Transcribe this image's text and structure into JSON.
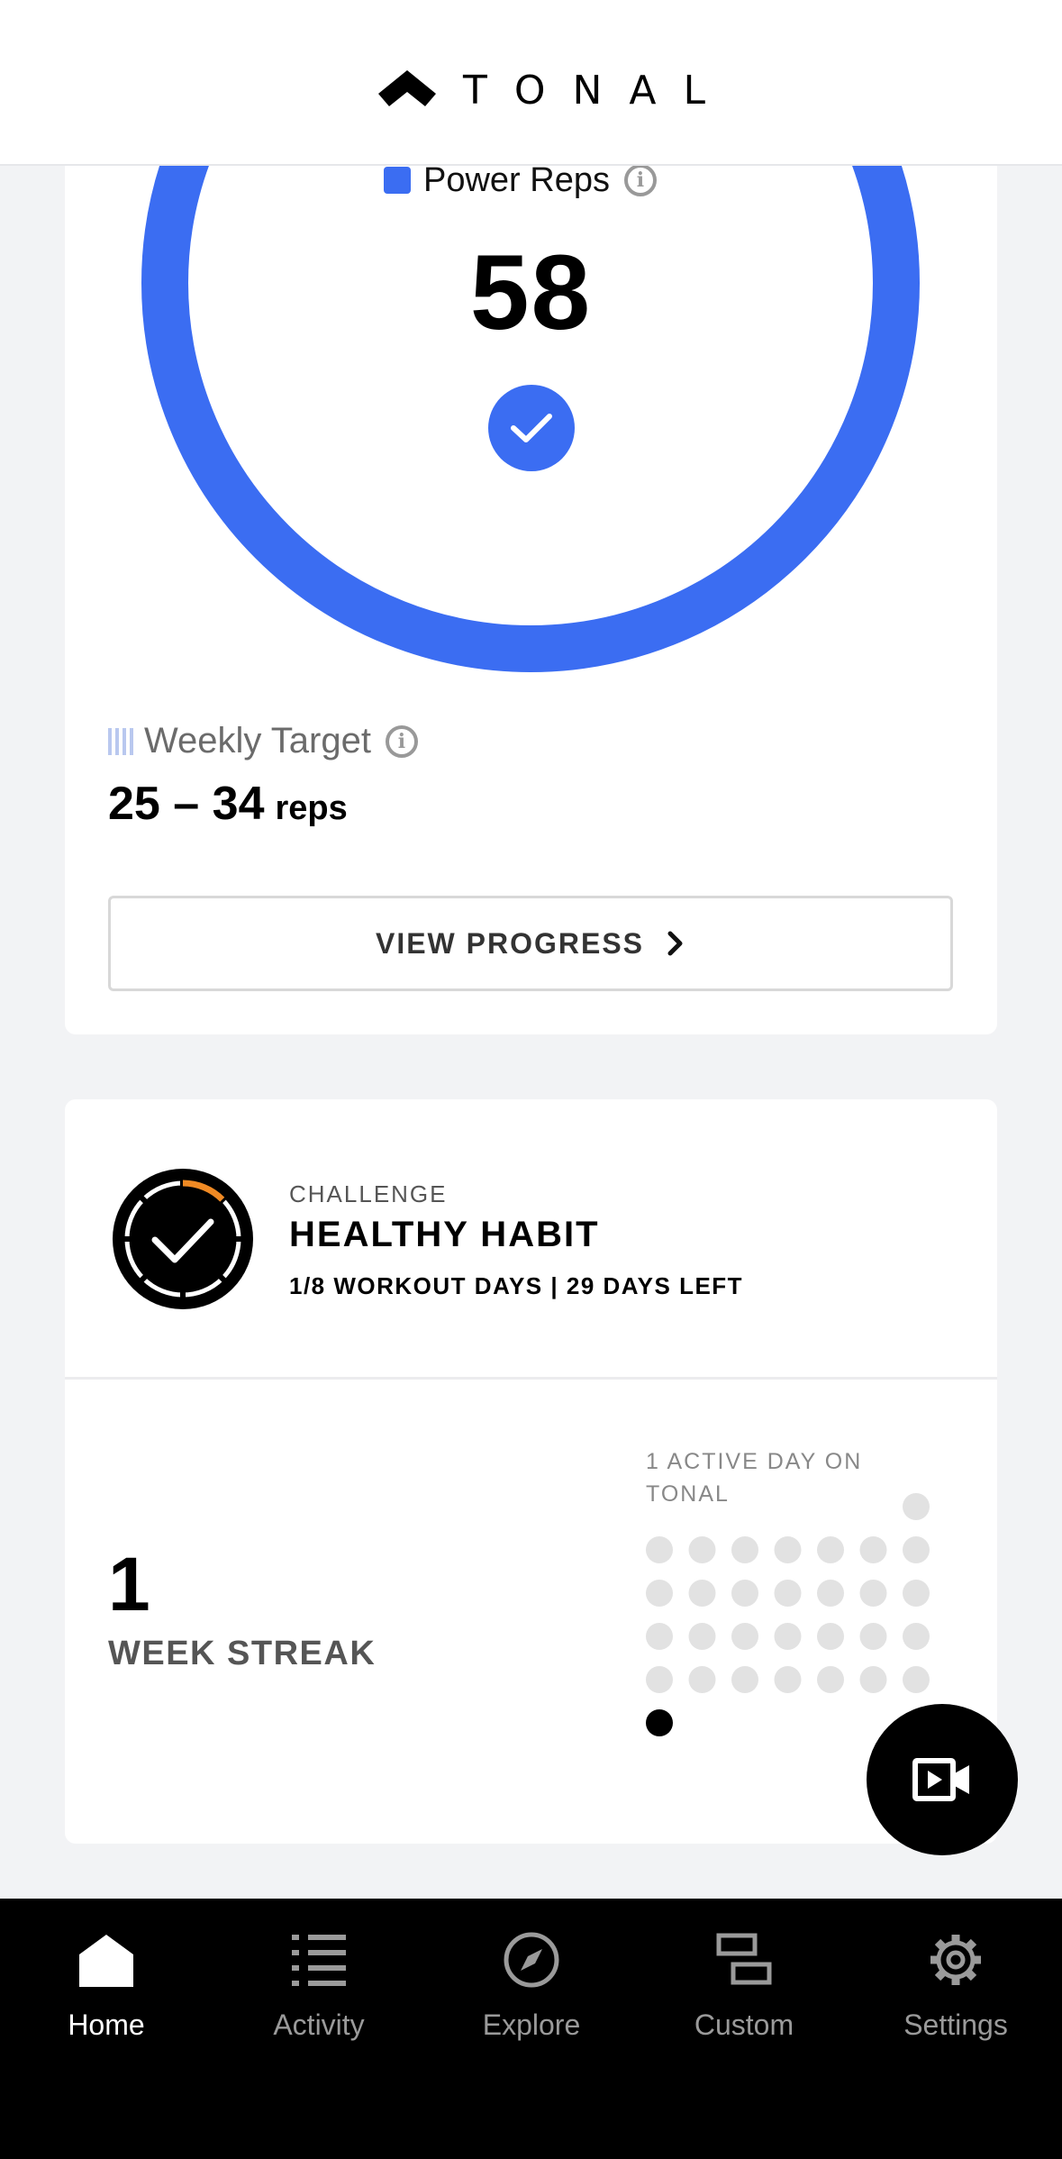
{
  "header": {
    "brand": "TONAL"
  },
  "progress_card": {
    "legend_label": "Power Reps",
    "legend_color": "#3b6df2",
    "value": "58",
    "goal_met": true,
    "target_label": "Weekly Target",
    "target_range": "25 – 34",
    "target_unit": "reps",
    "view_progress_label": "VIEW PROGRESS"
  },
  "challenge_card": {
    "kicker": "CHALLENGE",
    "title": "HEALTHY HABIT",
    "subtitle": "1/8 WORKOUT DAYS | 29 DAYS LEFT",
    "progress_fraction": 0.125,
    "accent_color": "#f08a24"
  },
  "streak": {
    "number": "1",
    "label": "WEEK STREAK",
    "active_label": "1 ACTIVE DAY ON TONAL",
    "active_days": 1
  },
  "fab": {
    "icon": "video-icon"
  },
  "bottom_nav": {
    "items": [
      {
        "label": "Home",
        "icon": "home-icon",
        "active": true
      },
      {
        "label": "Activity",
        "icon": "list-icon",
        "active": false
      },
      {
        "label": "Explore",
        "icon": "compass-icon",
        "active": false
      },
      {
        "label": "Custom",
        "icon": "custom-icon",
        "active": false
      },
      {
        "label": "Settings",
        "icon": "gear-icon",
        "active": false
      }
    ]
  }
}
